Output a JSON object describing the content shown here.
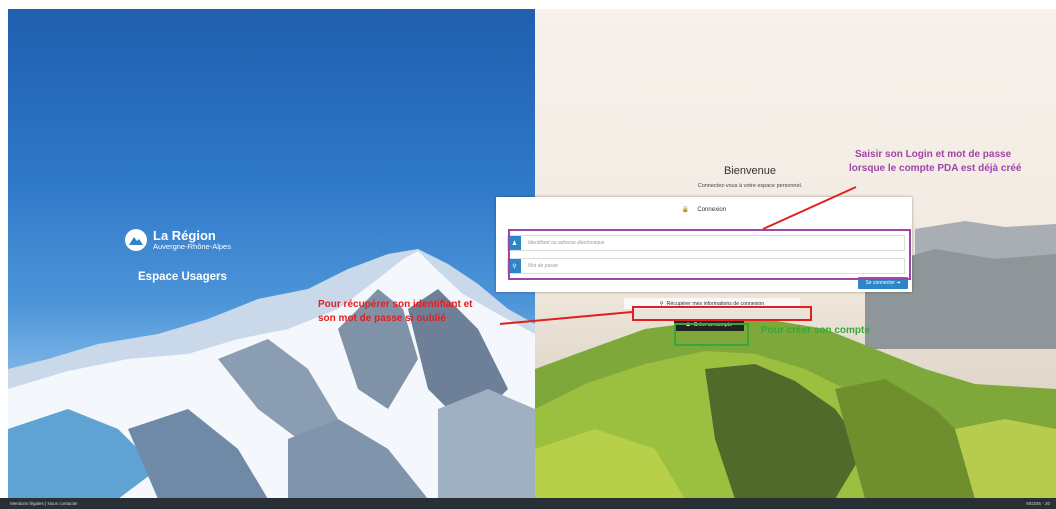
{
  "left": {
    "logo_name": "La Région",
    "logo_subtitle": "Auvergne-Rhône-Alpes",
    "space_title": "Espace Usagers"
  },
  "login": {
    "welcome_title": "Bienvenue",
    "welcome_subtitle": "Connectez-vous à votre espace personnel.",
    "header": "Connexion",
    "login_placeholder": "Identifiant ou adresse électronique",
    "password_placeholder": "Mot de passe",
    "connect_label": "Se connecter",
    "recover_label": "Récupérer mes informations de connexion",
    "create_label": "Créer un compte"
  },
  "annotations": {
    "login_note_line1": "Saisir son Login et mot de passe",
    "login_note_line2": "lorsque le compte PDA est déjà créé",
    "recover_note_line1": "Pour récupérer son identifiant et",
    "recover_note_line2": "son mot de passe si oublié",
    "create_note": "Pour créer son compte",
    "colors": {
      "purple": "#a044a8",
      "red": "#e02020",
      "green": "#3aa63a"
    }
  },
  "footer": {
    "left_text": "Mentions légales | Nous contacter",
    "right_text": "MGDIS - 20"
  }
}
